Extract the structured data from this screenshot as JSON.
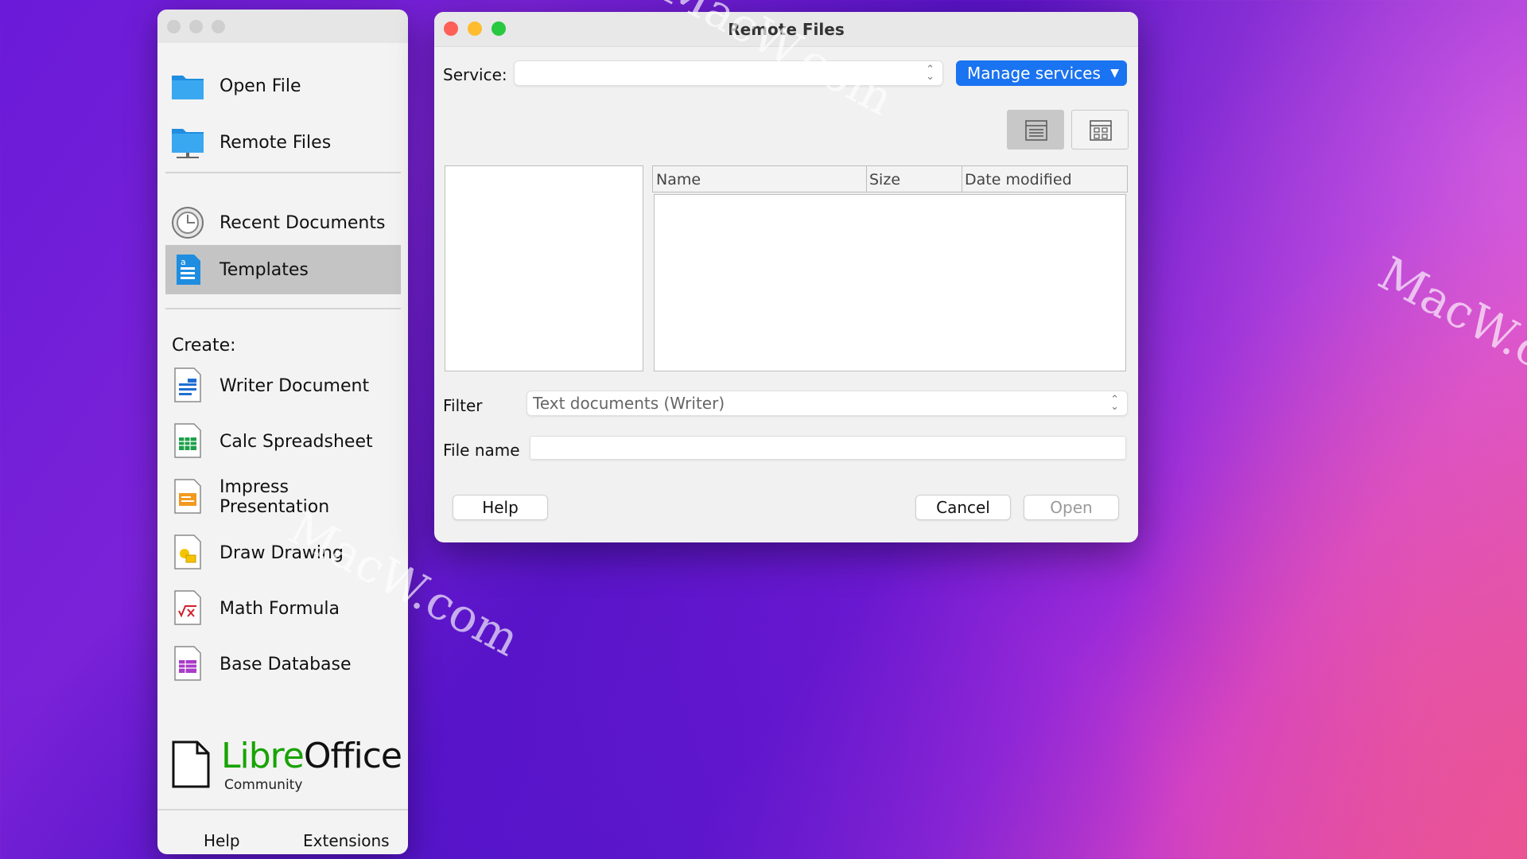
{
  "start_center": {
    "nav": [
      {
        "label": "Open File",
        "icon": "folder-icon"
      },
      {
        "label": "Remote Files",
        "icon": "remote-folder-icon"
      },
      {
        "label": "Recent Documents",
        "icon": "clock-icon"
      },
      {
        "label": "Templates",
        "icon": "templates-icon"
      }
    ],
    "create_label": "Create:",
    "create_items": [
      {
        "label": "Writer Document",
        "icon": "writer-icon"
      },
      {
        "label": "Calc Spreadsheet",
        "icon": "calc-icon"
      },
      {
        "label": "Impress Presentation",
        "icon": "impress-icon"
      },
      {
        "label": "Draw Drawing",
        "icon": "draw-icon"
      },
      {
        "label": "Math Formula",
        "icon": "math-icon"
      },
      {
        "label": "Base Database",
        "icon": "base-icon"
      }
    ],
    "logo": {
      "part1": "Libre",
      "part2": "Office",
      "sub": "Community"
    },
    "footer": {
      "help": "Help",
      "extensions": "Extensions"
    }
  },
  "dialog": {
    "title": "Remote Files",
    "service_label": "Service:",
    "service_value": "",
    "manage_services": "Manage services",
    "columns": [
      "Name",
      "Size",
      "Date modified"
    ],
    "filter_label": "Filter",
    "filter_value": "Text documents (Writer)",
    "filename_label": "File name",
    "filename_value": "",
    "help": "Help",
    "cancel": "Cancel",
    "open": "Open"
  },
  "watermark": "MacW.com",
  "colors": {
    "accent": "#1a73f0",
    "libre_green": "#18a303",
    "close": "#fe5f57",
    "minimize": "#febc2e",
    "zoom": "#28c840"
  }
}
